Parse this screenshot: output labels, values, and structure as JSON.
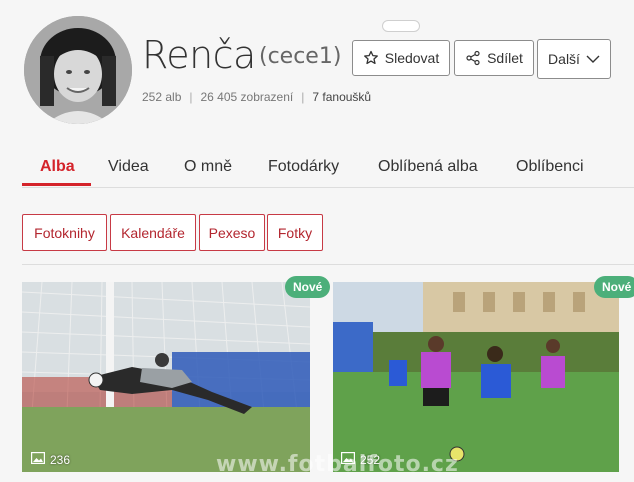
{
  "profile": {
    "name": "Renča",
    "username": "(cece1)",
    "stats": {
      "albums": "252 alb",
      "views": "26 405 zobrazení",
      "fans": "7 fanoušků"
    }
  },
  "actions": {
    "follow_label": "Sledovat",
    "share_label": "Sdílet",
    "more_label": "Další"
  },
  "tabs": [
    {
      "label": "Alba",
      "active": true
    },
    {
      "label": "Videa"
    },
    {
      "label": "O mně"
    },
    {
      "label": "Fotodárky"
    },
    {
      "label": "Oblíbená alba"
    },
    {
      "label": "Oblíbenci"
    }
  ],
  "categories": [
    "Fotoknihy",
    "Kalendáře",
    "Pexeso",
    "Fotky"
  ],
  "albums": [
    {
      "badge": "Nové",
      "count": "236"
    },
    {
      "badge": "Nové",
      "count": "252"
    }
  ],
  "watermark": "www.fotbalfoto.cz",
  "colors": {
    "accent": "#d4232a",
    "badge": "#4caf7a"
  }
}
